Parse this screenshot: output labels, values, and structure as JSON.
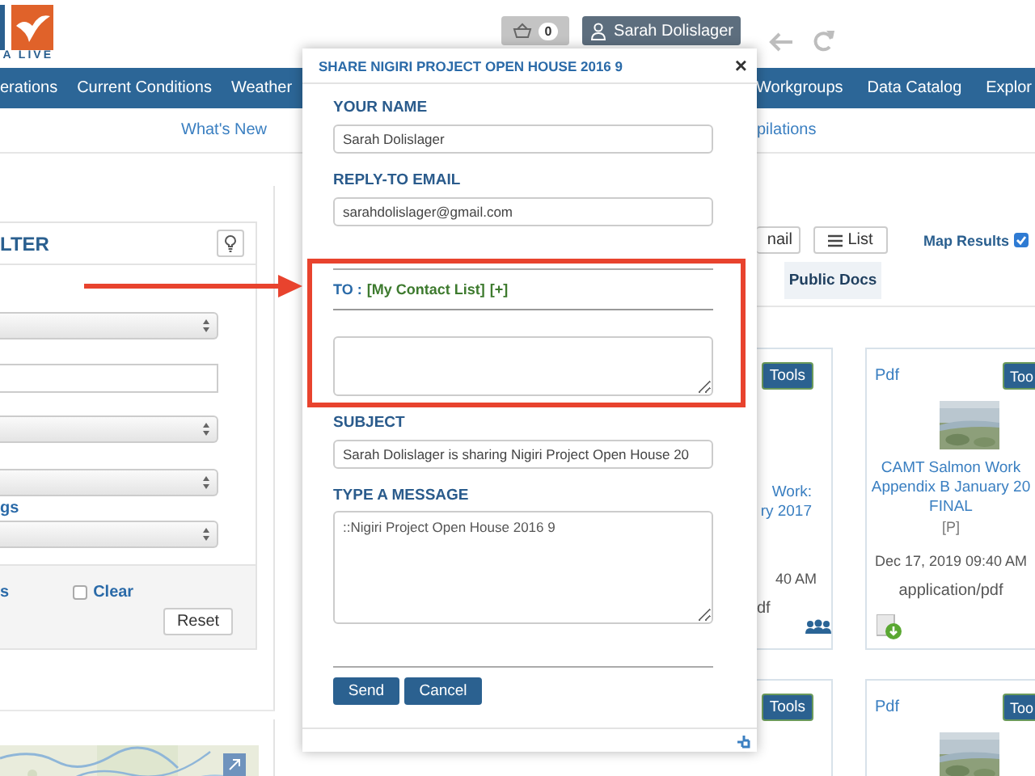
{
  "header": {
    "logo_caption": "A LIVE",
    "cart": {
      "count": "0"
    },
    "user": {
      "name": "Sarah Dolislager"
    }
  },
  "nav": {
    "left_items": [
      {
        "label": "erations"
      },
      {
        "label": "Current Conditions"
      },
      {
        "label": "Weather"
      }
    ],
    "right_items": [
      {
        "label": "Workgroups"
      },
      {
        "label": "Data Catalog"
      },
      {
        "label": "Explor"
      }
    ]
  },
  "subnav": {
    "items": [
      {
        "label": "What's New"
      },
      {
        "label": "pilations"
      }
    ]
  },
  "filter_panel": {
    "title": "LTER",
    "rows": [
      {
        "kind": "select"
      },
      {
        "kind": "input"
      },
      {
        "kind": "select"
      },
      {
        "kind": "select"
      },
      {
        "kind": "label",
        "text": "gs"
      },
      {
        "kind": "select"
      }
    ],
    "footer_label": "s",
    "clear": {
      "label": "Clear",
      "checked": false
    },
    "reset_label": "Reset"
  },
  "map": {
    "kind": "picture"
  },
  "results": {
    "view_buttons": [
      {
        "label": "nail",
        "kind": "text"
      },
      {
        "label": "List",
        "kind": "list"
      }
    ],
    "map_results": {
      "label": "Map Results",
      "checked": true
    },
    "tabs": [
      {
        "label": "Public Docs",
        "selected": true
      }
    ],
    "cards": [
      {
        "tools": "Tools",
        "title_lines": [
          "Work:",
          "ry 2017"
        ],
        "date": "40 AM",
        "mime": "df",
        "kind": "shared"
      },
      {
        "type": "Pdf",
        "tools": "Too",
        "thumbnail": {
          "kind": "picture"
        },
        "title_lines": [
          "CAMT Salmon Work",
          "Appendix B January 20",
          "FINAL"
        ],
        "tag": "[P]",
        "date": "Dec 17, 2019 09:40 AM",
        "mime": "application/pdf",
        "kind": "downloadable"
      },
      {
        "tools": "Tools",
        "kind": "plain"
      },
      {
        "type": "Pdf",
        "tools": "Too",
        "thumbnail": {
          "kind": "picture"
        },
        "kind": "plain"
      }
    ]
  },
  "share_dialog": {
    "title": "SHARE NIGIRI PROJECT OPEN HOUSE 2016 9",
    "close": "×",
    "fields": [
      {
        "kind": "input",
        "label": "YOUR NAME",
        "value": "Sarah Dolislager"
      },
      {
        "kind": "input",
        "label": "REPLY-TO EMAIL",
        "value": "sarahdolislager@gmail.com"
      },
      {
        "kind": "recipients",
        "label": "TO :",
        "contact_list": "[My Contact List]",
        "add": "[+]"
      },
      {
        "kind": "textarea"
      },
      {
        "kind": "input",
        "label": "SUBJECT",
        "value": "Sarah Dolislager is sharing Nigiri Project Open House 20"
      },
      {
        "kind": "textarea",
        "label": "TYPE A MESSAGE",
        "value": "::Nigiri Project Open House 2016 9"
      }
    ],
    "buttons": [
      {
        "label": "Send"
      },
      {
        "label": "Cancel"
      }
    ]
  }
}
